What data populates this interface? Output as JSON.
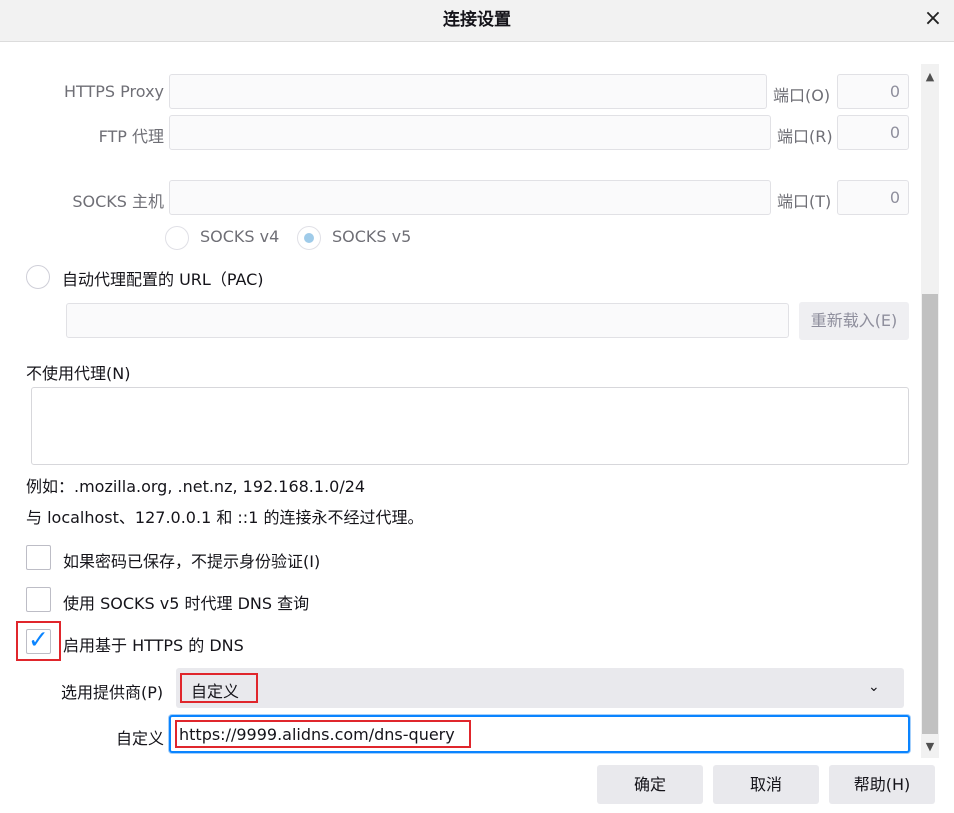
{
  "dialog": {
    "title": "连接设置",
    "close_icon": "×"
  },
  "proxy": {
    "https_label": "HTTPS Proxy",
    "https_value": "",
    "https_port_label": "端口(O)",
    "https_port": "0",
    "ftp_label": "FTP 代理",
    "ftp_value": "",
    "ftp_port_label": "端口(R)",
    "ftp_port": "0",
    "socks_label": "SOCKS 主机",
    "socks_value": "",
    "socks_port_label": "端口(T)",
    "socks_port": "0",
    "socks_v4": "SOCKS v4",
    "socks_v5": "SOCKS v5"
  },
  "pac": {
    "label": "自动代理配置的 URL（PAC)",
    "value": "",
    "reload_button": "重新载入(E)"
  },
  "no_proxy": {
    "label": "不使用代理(N)",
    "value": "",
    "example": "例如：.mozilla.org, .net.nz, 192.168.1.0/24",
    "note": "与 localhost、127.0.0.1 和 ::1 的连接永不经过代理。"
  },
  "options": {
    "no_auth_prompt": "如果密码已保存，不提示身份验证(I)",
    "socks_dns": "使用 SOCKS v5 时代理 DNS 查询",
    "doh": "启用基于 HTTPS 的 DNS",
    "doh_checked": true,
    "provider_label": "选用提供商(P)",
    "provider_value": "自定义",
    "custom_label": "自定义",
    "custom_value": "https://9999.alidns.com/dns-query"
  },
  "footer": {
    "ok_button": "确定",
    "cancel_button": "取消",
    "help_button": "帮助(H)"
  },
  "colors": {
    "accent": "#0a84ff",
    "highlight_box": "#e0262c"
  }
}
